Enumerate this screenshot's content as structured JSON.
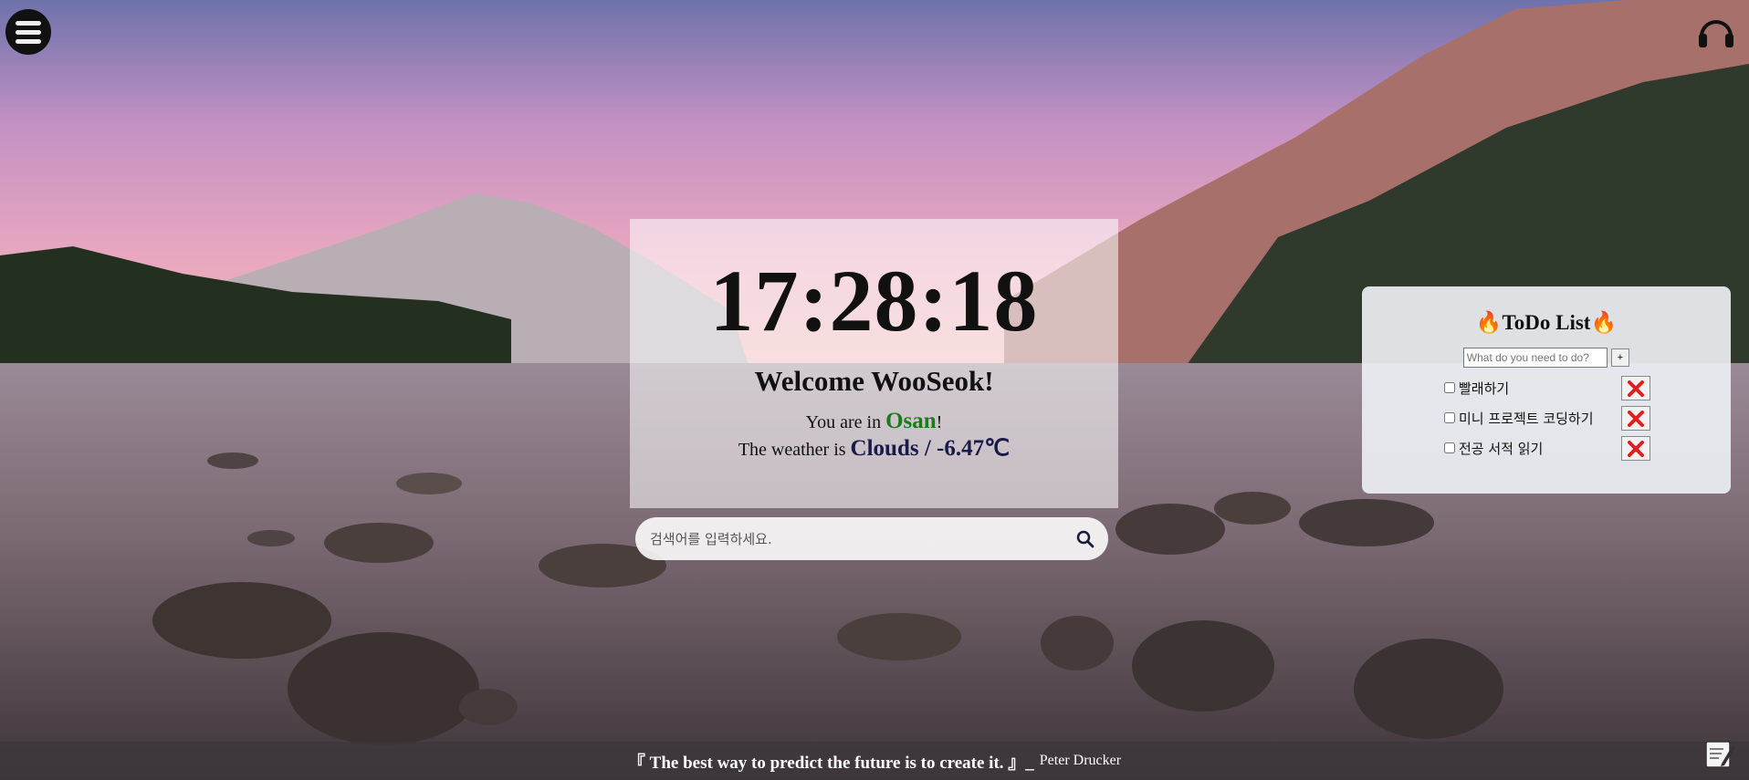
{
  "menu": {
    "icon": "hamburger-menu-icon"
  },
  "music": {
    "icon": "headphones-icon"
  },
  "clock": {
    "time": "17:28:18"
  },
  "greeting": {
    "text": "Welcome WooSeok!"
  },
  "location": {
    "prefix": "You are in ",
    "city": "Osan",
    "suffix": "!"
  },
  "weather": {
    "prefix": "The weather is ",
    "value": "Clouds / -6.47℃"
  },
  "search": {
    "placeholder": "검색어를 입력하세요.",
    "icon": "search-icon"
  },
  "todo": {
    "title": "🔥ToDo List🔥",
    "input_placeholder": "What do you need to do?",
    "add_label": "+",
    "items": [
      {
        "text": "빨래하기",
        "checked": false
      },
      {
        "text": "미니 프로젝트 코딩하기",
        "checked": false
      },
      {
        "text": "전공 서적 읽기",
        "checked": false
      }
    ],
    "delete_icon": "red-x-icon"
  },
  "quote": {
    "text": "『 The best way to predict the future is to create it. 』_",
    "author": "Peter Drucker"
  },
  "note": {
    "icon": "note-pencil-icon"
  },
  "colors": {
    "city": "#1f7a1f",
    "weather": "#1a1a4a",
    "delete": "#e02020"
  }
}
